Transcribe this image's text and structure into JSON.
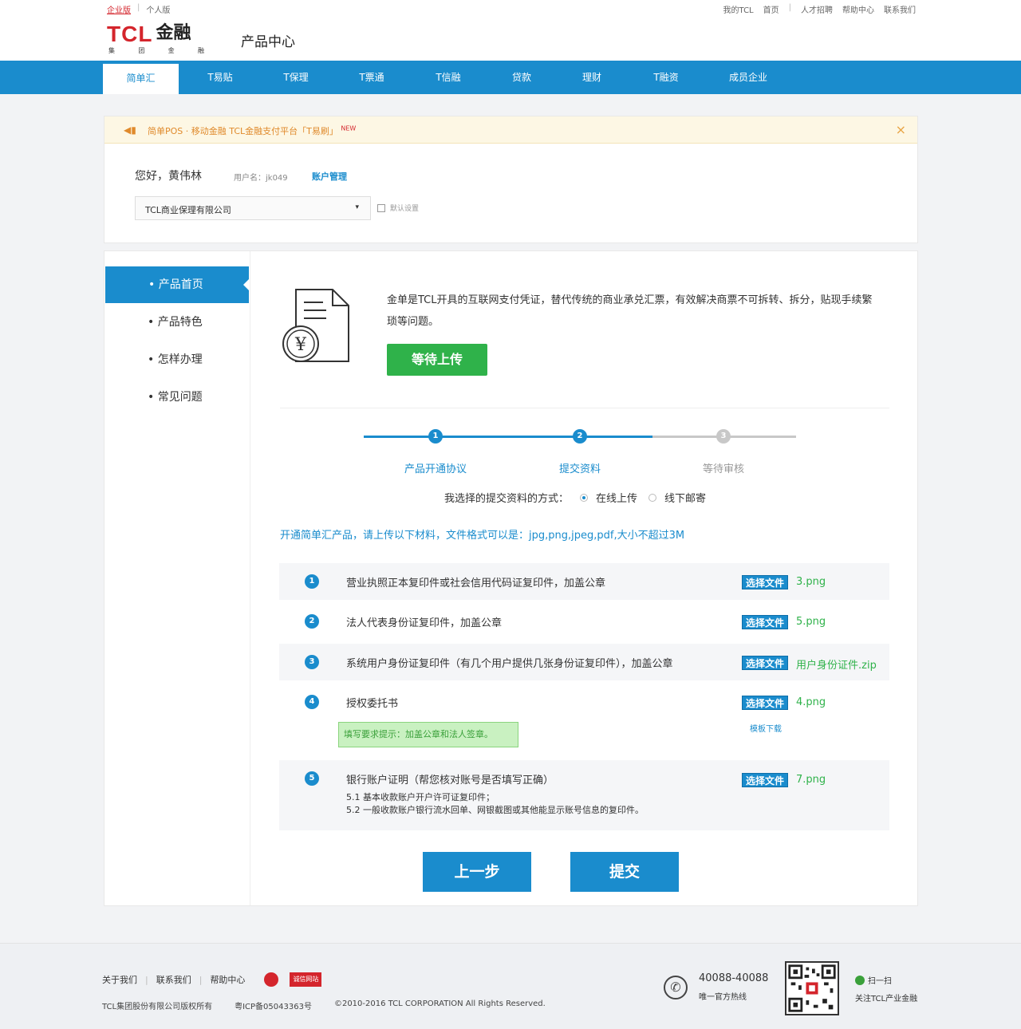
{
  "topbar": {
    "left": [
      "企业版",
      "个人版"
    ],
    "right": [
      "我的TCL",
      "首页",
      "人才招聘",
      "帮助中心",
      "联系我们"
    ]
  },
  "header": {
    "logo_main": "TCL",
    "logo_jr": "金融",
    "logo_sub": [
      "集",
      "团",
      "金",
      "融"
    ],
    "page_title": "产品中心"
  },
  "nav": {
    "items": [
      "简单汇",
      "T易贴",
      "T保理",
      "T票通",
      "T信融",
      "贷款",
      "理财",
      "T融资",
      "成员企业"
    ]
  },
  "notice": {
    "icon": "speaker-icon",
    "text": "简单POS · 移动金融 TCL金融支付平台「T易刷」",
    "badge": "NEW",
    "close": "×"
  },
  "user": {
    "greeting": "您好，黄伟林",
    "username": "用户名：jk049",
    "account_link": "账户管理",
    "company": "TCL商业保理有限公司",
    "caret": "▾",
    "default_label": "默认设置"
  },
  "sidebar": {
    "items": [
      "• 产品首页",
      "• 产品特色",
      "• 怎样办理",
      "• 常见问题"
    ]
  },
  "intro": {
    "text": "金单是TCL开具的互联网支付凭证，替代传统的商业承兑汇票，有效解决商票不可拆转、拆分，贴现手续繁琐等问题。",
    "status_button": "等待上传"
  },
  "steps": {
    "items": [
      {
        "num": "1",
        "label": "产品开通协议"
      },
      {
        "num": "2",
        "label": "提交资料"
      },
      {
        "num": "3",
        "label": "等待审核"
      }
    ],
    "method_label": "我选择的提交资料的方式：",
    "method_online": "在线上传",
    "method_offline": "线下邮寄"
  },
  "upload": {
    "hint": "开通简单汇产品，请上传以下材料，文件格式可以是：jpg,png,jpeg,pdf,大小不超过3M",
    "choose_label": "选择文件",
    "template_link": "模板下载",
    "tip": "填写要求提示：加盖公章和法人签章。",
    "rows": [
      {
        "num": "1",
        "text": "营业执照正本复印件或社会信用代码证复印件，加盖公章",
        "file": "3.png"
      },
      {
        "num": "2",
        "text": "法人代表身份证复印件，加盖公章",
        "file": "5.png"
      },
      {
        "num": "3",
        "text": "系统用户身份证复印件（有几个用户提供几张身份证复印件），加盖公章",
        "file": "用户身份证件.zip"
      },
      {
        "num": "4",
        "text": "授权委托书",
        "file": "4.png"
      },
      {
        "num": "5",
        "text": "银行账户证明（帮您核对账号是否填写正确）",
        "file": "7.png",
        "subs": [
          "5.1 基本收款账户开户许可证复印件；",
          "5.2 一般收款账户银行流水回单、网银截图或其他能显示账号信息的复印件。"
        ]
      }
    ]
  },
  "actions": {
    "prev": "上一步",
    "submit": "提交"
  },
  "footer": {
    "links": [
      "关于我们",
      "联系我们",
      "帮助中心"
    ],
    "badge_text": "诚信网站",
    "copyright": [
      "TCL集团股份有限公司版权所有",
      "粤ICP备05043363号",
      "©2010-2016 TCL CORPORATION All Rights Reserved."
    ],
    "hotline": "40088-40088",
    "hotline_sub": "唯一官方热线",
    "wechat": "扫一扫",
    "wechat_sub": "关注TCL产业金融"
  },
  "colors": {
    "brand_red": "#d4252c",
    "brand_blue": "#1a8ccd",
    "success_green": "#2fb24a"
  }
}
